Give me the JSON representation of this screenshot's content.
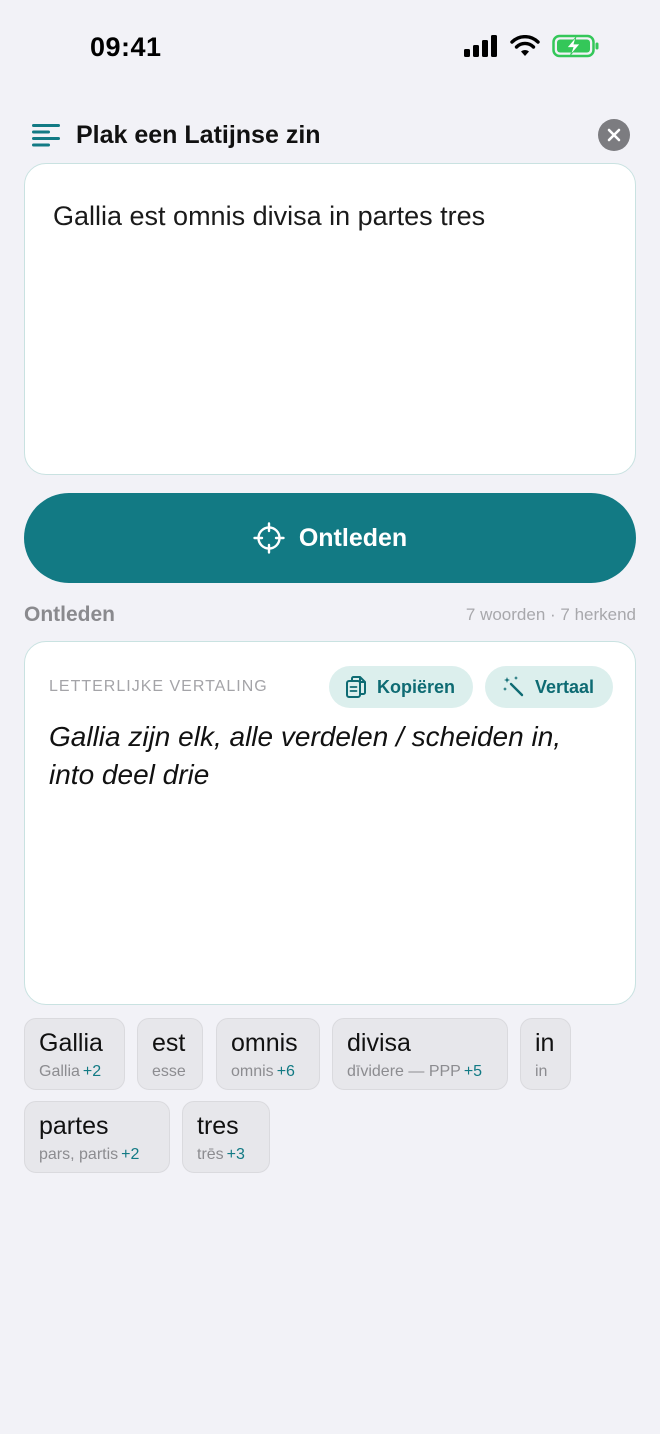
{
  "status_bar": {
    "time": "09:41"
  },
  "header": {
    "title": "Plak een Latijnse zin"
  },
  "input": {
    "text": "Gallia est omnis divisa in partes tres"
  },
  "primary_button": {
    "label": "Ontleden"
  },
  "section": {
    "title": "Ontleden",
    "meta": "7 woorden · 7 herkend"
  },
  "translation": {
    "label": "LETTERLIJKE VERTALING",
    "copy_label": "Kopiëren",
    "translate_label": "Vertaal",
    "text": "Gallia zijn elk, alle verdelen / scheiden in, into deel drie"
  },
  "words": [
    {
      "word": "Gallia",
      "lemma": "Gallia",
      "count": "+2"
    },
    {
      "word": "est",
      "lemma": "esse",
      "count": ""
    },
    {
      "word": "omnis",
      "lemma": "omnis",
      "count": "+6"
    },
    {
      "word": "divisa",
      "lemma": "dīvidere — PPP",
      "count": "+5"
    },
    {
      "word": "in",
      "lemma": "in",
      "count": ""
    },
    {
      "word": "partes",
      "lemma": "pars, partis",
      "count": "+2"
    },
    {
      "word": "tres",
      "lemma": "trēs",
      "count": "+3"
    }
  ],
  "colors": {
    "accent": "#127a84",
    "accent_soft": "#dcefed",
    "background": "#f2f2f7",
    "battery": "#34c759"
  },
  "icons": [
    "signal-icon",
    "wifi-icon",
    "battery-charging-icon",
    "menu-lines-icon",
    "close-icon",
    "crosshair-icon",
    "copy-icon",
    "magic-wand-icon"
  ]
}
